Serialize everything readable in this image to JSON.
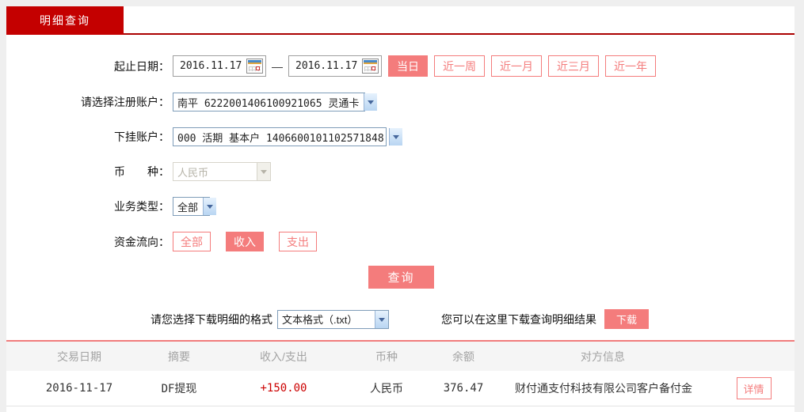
{
  "tab": {
    "label": "明细查询"
  },
  "form": {
    "date_range": {
      "label": "起止日期：",
      "start_value": "2016.11.17",
      "separator": "—",
      "end_value": "2016.11.17"
    },
    "quick_ranges": [
      {
        "label": "当日",
        "active": true
      },
      {
        "label": "近一周",
        "active": false
      },
      {
        "label": "近一月",
        "active": false
      },
      {
        "label": "近三月",
        "active": false
      },
      {
        "label": "近一年",
        "active": false
      }
    ],
    "register_account": {
      "label": "请选择注册账户：",
      "value": "南平 6222001406100921065 灵通卡"
    },
    "sub_account": {
      "label": "下挂账户：",
      "value": "000 活期 基本户 1406600101102571848"
    },
    "currency": {
      "label": "币　　种：",
      "value": "人民币",
      "disabled": true
    },
    "business_type": {
      "label": "业务类型：",
      "value": "全部"
    },
    "fund_flow": {
      "label": "资金流向：",
      "options": [
        {
          "label": "全部",
          "active": false
        },
        {
          "label": "收入",
          "active": true
        },
        {
          "label": "支出",
          "active": false
        }
      ]
    },
    "query_button": "查询"
  },
  "download": {
    "format_label": "请您选择下载明细的格式",
    "format_value": "文本格式（.txt）",
    "hint": "您可以在这里下载查询明细结果",
    "button": "下载"
  },
  "table": {
    "headers": [
      "交易日期",
      "摘要",
      "收入/支出",
      "币种",
      "余额",
      "对方信息"
    ],
    "rows": [
      {
        "date": "2016-11-17",
        "summary": "DF提现",
        "amount": "+150.00",
        "currency": "人民币",
        "balance": "376.47",
        "counterparty": "财付通支付科技有限公司客户备付金",
        "detail_button": "详情"
      }
    ]
  },
  "colors": {
    "brand_red": "#c40000",
    "accent_salmon": "#f47c7c",
    "amount_red": "#cc0000"
  }
}
